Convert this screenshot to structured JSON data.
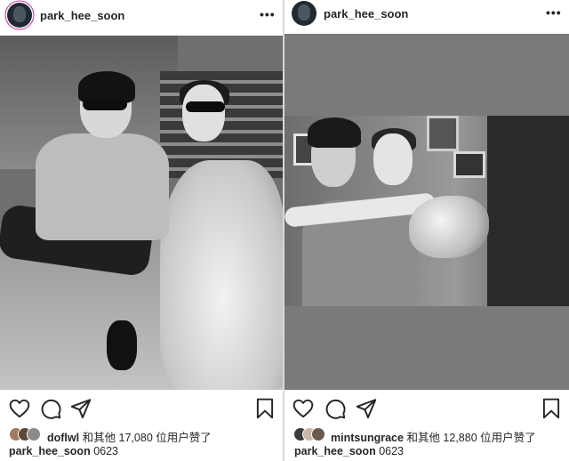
{
  "posts": [
    {
      "username": "park_hee_soon",
      "more_icon": "more-horizontal-icon",
      "photo_description_icon": "photo",
      "likes": {
        "user": "doflwl",
        "suffix": " 和其他 17,080 位用户赞了"
      },
      "caption": {
        "user": "park_hee_soon",
        "text": " 0623"
      }
    },
    {
      "username": "park_hee_soon",
      "more_icon": "more-horizontal-icon",
      "likes": {
        "user": "mintsungrace",
        "suffix": " 和其他 12,880 位用户赞了"
      },
      "caption": {
        "user": "park_hee_soon",
        "text": " 0623"
      }
    }
  ],
  "more_label": "•••",
  "colors": {
    "text": "#262626",
    "story_ring": "#d6249f",
    "divider": "#d8d8d8"
  },
  "icons": [
    "heart-icon",
    "comment-icon",
    "share-icon",
    "bookmark-icon",
    "more-horizontal-icon"
  ]
}
